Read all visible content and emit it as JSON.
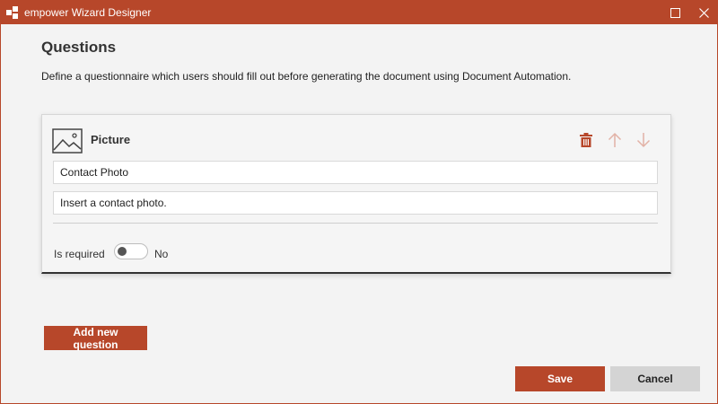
{
  "window": {
    "title": "empower Wizard Designer",
    "accent_color": "#b7472a"
  },
  "titlebar": {
    "app_icon": "empower-logo-icon",
    "maximize_icon": "maximize-icon",
    "close_icon": "close-icon"
  },
  "page": {
    "heading": "Questions",
    "description": "Define a questionnaire which users should fill out before generating the document using Document Automation."
  },
  "question_card": {
    "type_icon": "picture-icon",
    "type_label": "Picture",
    "actions": {
      "delete_icon": "trash-icon",
      "move_up_icon": "arrow-up-icon",
      "move_down_icon": "arrow-down-icon"
    },
    "name_value": "Contact Photo",
    "description_value": "Insert a contact photo.",
    "required_label": "Is required",
    "required_state": "No"
  },
  "buttons": {
    "add_question": "Add new question",
    "save": "Save",
    "cancel": "Cancel"
  }
}
